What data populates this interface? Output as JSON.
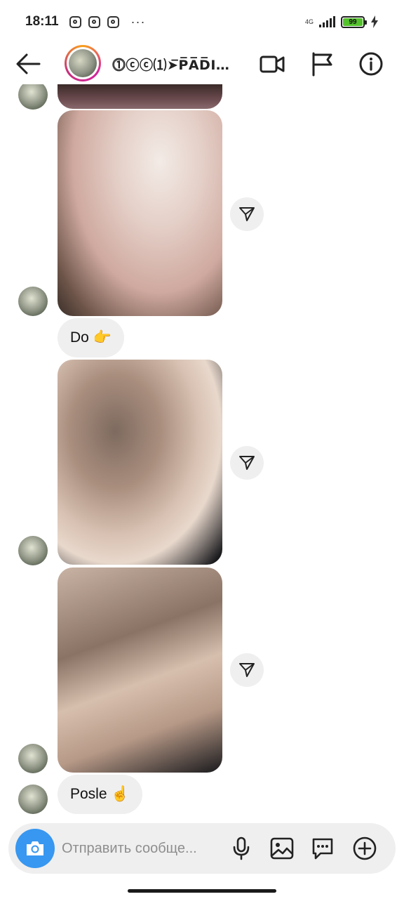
{
  "status_bar": {
    "time": "18:11",
    "notification_icons": [
      "instagram-icon",
      "instagram-icon",
      "instagram-icon"
    ],
    "more": "···",
    "network": "4G",
    "battery_level": "99",
    "battery_color": "#53c22b",
    "charging_icon": "bolt-icon"
  },
  "header": {
    "contact_name": "⓵ⓒⓒ⑴➤̅P̅A̅D̅I…",
    "back_icon": "arrow-left-icon",
    "video_icon": "video-camera-icon",
    "flag_icon": "flag-icon",
    "info_icon": "info-icon"
  },
  "messages": {
    "text_1": "Do 👉",
    "text_2": "Posle ☝️",
    "share_icon": "send-icon"
  },
  "composer": {
    "placeholder": "Отправить сообще...",
    "camera_icon": "camera-icon",
    "mic_icon": "microphone-icon",
    "gallery_icon": "image-icon",
    "sticker_icon": "chat-bubble-icon",
    "more_icon": "plus-circle-icon",
    "accent_color": "#3897f0"
  }
}
